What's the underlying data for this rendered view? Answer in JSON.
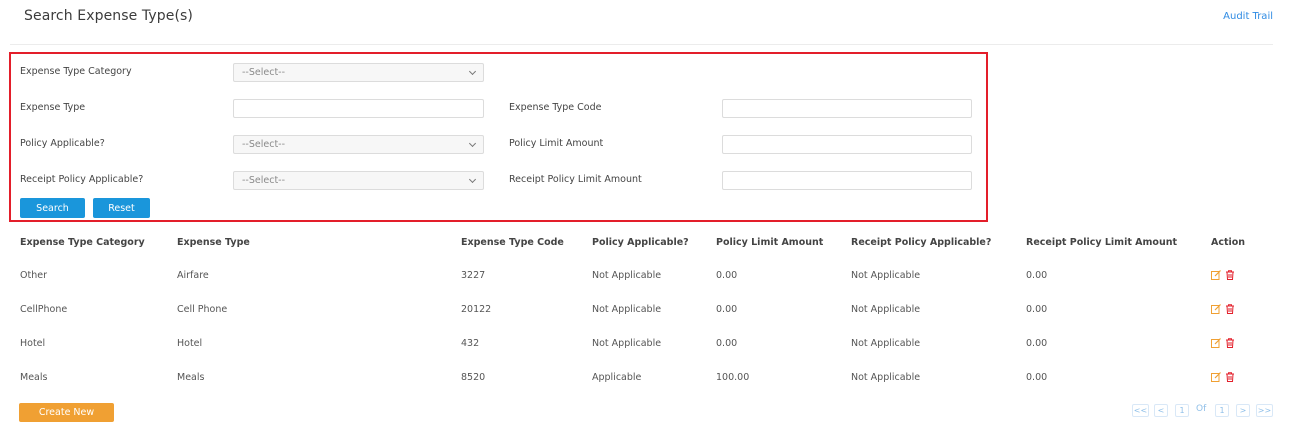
{
  "header": {
    "title": "Search Expense Type(s)",
    "audit_link": "Audit Trail"
  },
  "search_form": {
    "category_label": "Expense Type Category",
    "category_value": "--Select--",
    "type_label": "Expense Type",
    "type_value": "",
    "code_label": "Expense Type Code",
    "code_value": "",
    "policy_label": "Policy Applicable?",
    "policy_value": "--Select--",
    "limit_label": "Policy Limit Amount",
    "limit_value": "",
    "receipt_label": "Receipt Policy Applicable?",
    "receipt_value": "--Select--",
    "receipt_limit_label": "Receipt Policy Limit Amount",
    "receipt_limit_value": "",
    "search_button": "Search",
    "reset_button": "Reset"
  },
  "table": {
    "headers": [
      "Expense Type Category",
      "Expense Type",
      "Expense Type Code",
      "Policy Applicable?",
      "Policy Limit Amount",
      "Receipt Policy Applicable?",
      "Receipt Policy Limit Amount",
      "Action"
    ],
    "rows": [
      [
        "Other",
        "Airfare",
        "3227",
        "Not Applicable",
        "0.00",
        "Not Applicable",
        "0.00"
      ],
      [
        "CellPhone",
        "Cell Phone",
        "20122",
        "Not Applicable",
        "0.00",
        "Not Applicable",
        "0.00"
      ],
      [
        "Hotel",
        "Hotel",
        "432",
        "Not Applicable",
        "0.00",
        "Not Applicable",
        "0.00"
      ],
      [
        "Meals",
        "Meals",
        "8520",
        "Applicable",
        "100.00",
        "Not Applicable",
        "0.00"
      ]
    ]
  },
  "footer": {
    "create_button": "Create New",
    "pagination": {
      "first": "<<",
      "prev": "<",
      "current": "1",
      "of": "Of",
      "total": "1",
      "next": ">",
      "last": ">>"
    }
  },
  "icons": {
    "edit": "edit-icon",
    "delete": "trash-icon"
  },
  "colors": {
    "accent_blue": "#1a96db",
    "create_orange": "#f0a033",
    "highlight_red": "#e31e2a",
    "link_blue": "#2f8be3"
  }
}
